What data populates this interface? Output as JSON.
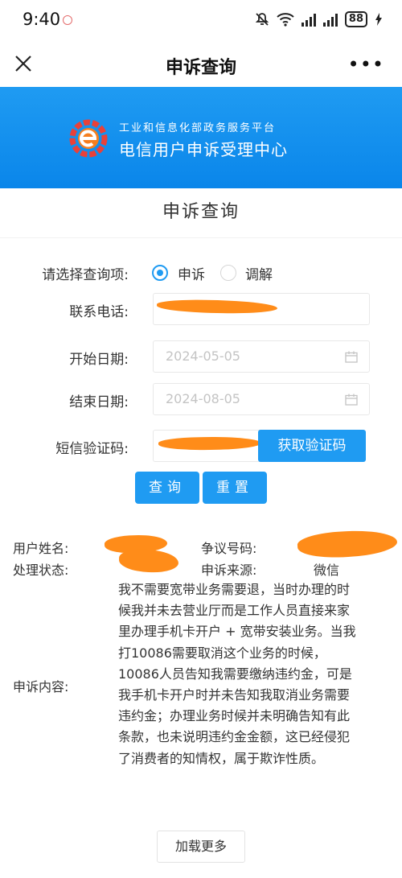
{
  "status_bar": {
    "time": "9:40",
    "battery": "88"
  },
  "nav": {
    "title": "申诉查询"
  },
  "banner": {
    "subtitle": "工业和信息化部政务服务平台",
    "title": "电信用户申诉受理中心"
  },
  "page": {
    "section_title": "申诉查询"
  },
  "form": {
    "query_type_label": "请选择查询项:",
    "options": [
      {
        "label": "申诉",
        "selected": true
      },
      {
        "label": "调解",
        "selected": false
      }
    ],
    "phone_label": "联系电话:",
    "start_label": "开始日期:",
    "start_value": "2024-05-05",
    "end_label": "结束日期:",
    "end_value": "2024-08-05",
    "sms_label": "短信验证码:",
    "get_code_button": "获取验证码",
    "query_button": "查询",
    "reset_button": "重置"
  },
  "result": {
    "name_label": "用户姓名:",
    "dispute_label": "争议号码:",
    "status_label": "处理状态:",
    "source_label": "申诉来源:",
    "source_value": "微信",
    "content_label": "申诉内容:",
    "content": "我不需要宽带业务需要退，当时办理的时候我并未去营业厅而是工作人员直接来家里办理手机卡开户 + 宽带安装业务。当我打10086需要取消这个业务的时候，10086人员告知我需要缴纳违约金，可是我手机卡开户时并未告知我取消业务需要违约金；办理业务时候并未明确告知有此条款，也未说明违约金金额，这已经侵犯了消费者的知情权，属于欺诈性质。"
  },
  "load_more": "加载更多",
  "colors": {
    "primary": "#1f9bf2",
    "redaction": "#ff8c19",
    "accent_red": "#e8413a"
  }
}
